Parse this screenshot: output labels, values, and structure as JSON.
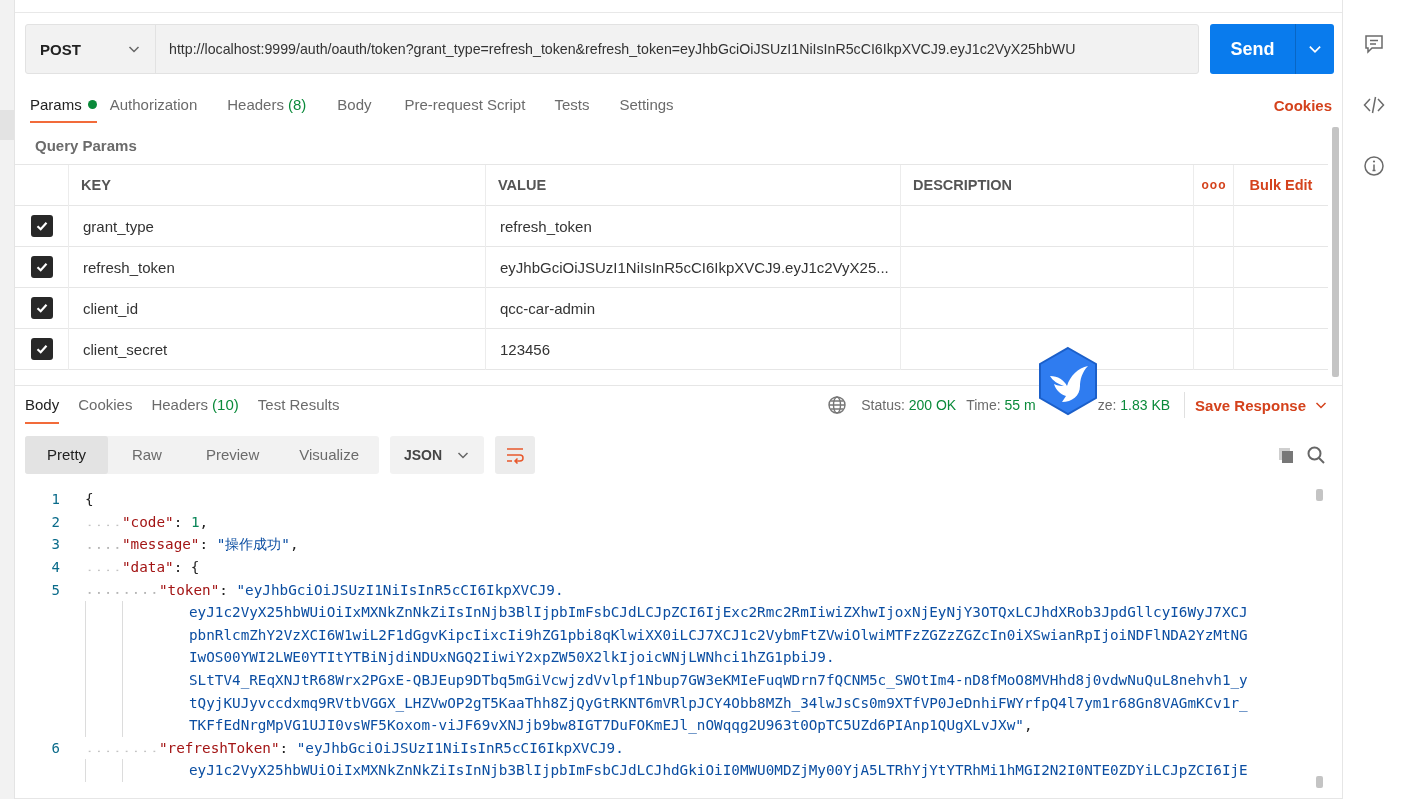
{
  "request": {
    "method": "POST",
    "url": "http://localhost:9999/auth/oauth/token?grant_type=refresh_token&refresh_token=eyJhbGciOiJSUzI1NiIsInR5cCI6IkpXVCJ9.eyJ1c2VyX25hbWU",
    "send_label": "Send"
  },
  "request_tabs": [
    {
      "label": "Params",
      "selected": true,
      "has_content": true
    },
    {
      "label": "Authorization",
      "selected": false,
      "has_content": false
    },
    {
      "label": "Headers",
      "count": "(8)",
      "selected": false,
      "has_content": false
    },
    {
      "label": "Body",
      "selected": false,
      "has_content": false
    },
    {
      "label": "Pre-request Script",
      "selected": false,
      "has_content": false
    },
    {
      "label": "Tests",
      "selected": false,
      "has_content": false
    },
    {
      "label": "Settings",
      "selected": false,
      "has_content": false
    }
  ],
  "cookies_link": "Cookies",
  "query_params": {
    "title": "Query Params",
    "columns": [
      "KEY",
      "VALUE",
      "DESCRIPTION"
    ],
    "more_label": "ooo",
    "bulk_edit": "Bulk Edit",
    "rows": [
      {
        "checked": true,
        "key": "grant_type",
        "value": "refresh_token"
      },
      {
        "checked": true,
        "key": "refresh_token",
        "value": "eyJhbGciOiJSUzI1NiIsInR5cCI6IkpXVCJ9.eyJ1c2VyX25..."
      },
      {
        "checked": true,
        "key": "client_id",
        "value": "qcc-car-admin"
      },
      {
        "checked": true,
        "key": "client_secret",
        "value": "123456"
      }
    ]
  },
  "response": {
    "tabs": [
      {
        "label": "Body",
        "selected": true
      },
      {
        "label": "Cookies",
        "selected": false
      },
      {
        "label": "Headers",
        "count": "(10)",
        "selected": false
      },
      {
        "label": "Test Results",
        "selected": false
      }
    ],
    "status": [
      {
        "label": "Status:",
        "value": "200 OK"
      },
      {
        "label": "Time:",
        "value": "55 m"
      },
      {
        "label": "ze:",
        "value": "1.83 KB"
      }
    ],
    "save_label": "Save Response",
    "views": [
      {
        "label": "Pretty",
        "selected": true
      },
      {
        "label": "Raw",
        "selected": false
      },
      {
        "label": "Preview",
        "selected": false
      },
      {
        "label": "Visualize",
        "selected": false
      }
    ],
    "format": "JSON",
    "lines": [
      {
        "number": "1",
        "parts": [
          {
            "kind": "punct",
            "text": "{"
          }
        ],
        "children": [
          {
            "number": "2",
            "parts": [
              {
                "kind": "key",
                "text": "\"code\""
              },
              {
                "kind": "punct",
                "text": ": "
              },
              {
                "kind": "number",
                "text": "1"
              },
              {
                "kind": "punct",
                "text": ","
              }
            ]
          },
          {
            "number": "3",
            "parts": [
              {
                "kind": "key",
                "text": "\"message\""
              },
              {
                "kind": "punct",
                "text": ": "
              },
              {
                "kind": "string",
                "text": "\"操作成功\""
              },
              {
                "kind": "punct",
                "text": ","
              }
            ]
          },
          {
            "number": "4",
            "parts": [
              {
                "kind": "key",
                "text": "\"data\""
              },
              {
                "kind": "punct",
                "text": ": {"
              }
            ],
            "children": [
              {
                "number": "5",
                "parts": [
                  {
                    "kind": "key",
                    "text": "\"token\""
                  },
                  {
                    "kind": "punct",
                    "text": ": "
                  },
                  {
                    "kind": "string",
                    "text": "\"eyJhbGciOiJSUzI1NiIsInR5cCI6IkpXVCJ9."
                  }
                ],
                "wrapped": [
                  [
                    {
                      "kind": "string",
                      "text": "eyJ1c2VyX25hbWUiOiIxMXNkZnNkZiIsInNjb3BlIjpbImFsbCJdLCJpZCI6IjExc2Rmc2RmIiwiZXhwIjoxNjEyNjY3OTQxLCJhdXRob3JpdGllcyI6WyJ7XCJ"
                    }
                  ],
                  [
                    {
                      "kind": "string",
                      "text": "pbnRlcmZhY2VzXCI6W1wiL2F1dGgvKipcIixcIi9hZG1pbi8qKlwiXX0iLCJ7XCJ1c2VybmFtZVwiOlwiMTFzZGZzZGZcIn0iXSwianRpIjoiNDFlNDA2YzMtNG"
                    }
                  ],
                  [
                    {
                      "kind": "string",
                      "text": "IwOS00YWI2LWE0YTItYTBiNjdiNDUxNGQ2IiwiY2xpZW50X2lkIjoicWNjLWNhci1hZG1pbiJ9."
                    }
                  ],
                  [
                    {
                      "kind": "string",
                      "text": "SLtTV4_REqXNJtR68Wrx2PGxE-QBJEup9DTbq5mGiVcwjzdVvlpf1Nbup7GW3eKMIeFuqWDrn7fQCNM5c_SWOtIm4-nD8fMoO8MVHhd8j0vdwNuQuL8nehvh1_y"
                    }
                  ],
                  [
                    {
                      "kind": "string",
                      "text": "tQyjKUJyvccdxmq9RVtbVGGX_LHZVwOP2gT5KaaThh8ZjQyGtRKNT6mVRlpJCY4Obb8MZh_34lwJsCs0m9XTfVP0JeDnhiFWYrfpQ4l7ym1r68Gn8VAGmKCv1r_"
                    }
                  ],
                  [
                    {
                      "kind": "string",
                      "text": "TKFfEdNrgMpVG1UJI0vsWF5Koxom-viJF69vXNJjb9bw8IGT7DuFOKmEJl_nOWqqg2U963t0OpTC5UZd6PIAnp1QUgXLvJXw\""
                    },
                    {
                      "kind": "punct",
                      "text": ","
                    }
                  ]
                ]
              },
              {
                "number": "6",
                "parts": [
                  {
                    "kind": "key",
                    "text": "\"refreshToken\""
                  },
                  {
                    "kind": "punct",
                    "text": ": "
                  },
                  {
                    "kind": "string",
                    "text": "\"eyJhbGciOiJSUzI1NiIsInR5cCI6IkpXVCJ9."
                  }
                ],
                "wrapped": [
                  [
                    {
                      "kind": "string",
                      "text": "eyJ1c2VyX25hbWUiOiIxMXNkZnNkZiIsInNjb3BlIjpbImFsbCJdLCJhdGkiOiI0MWU0MDZjMy00YjA5LTRhYjYtYTRhMi1hMGI2N2I0NTE0ZDYiLCJpZCI6IjE"
                    }
                  ]
                ]
              }
            ]
          }
        ]
      }
    ]
  }
}
